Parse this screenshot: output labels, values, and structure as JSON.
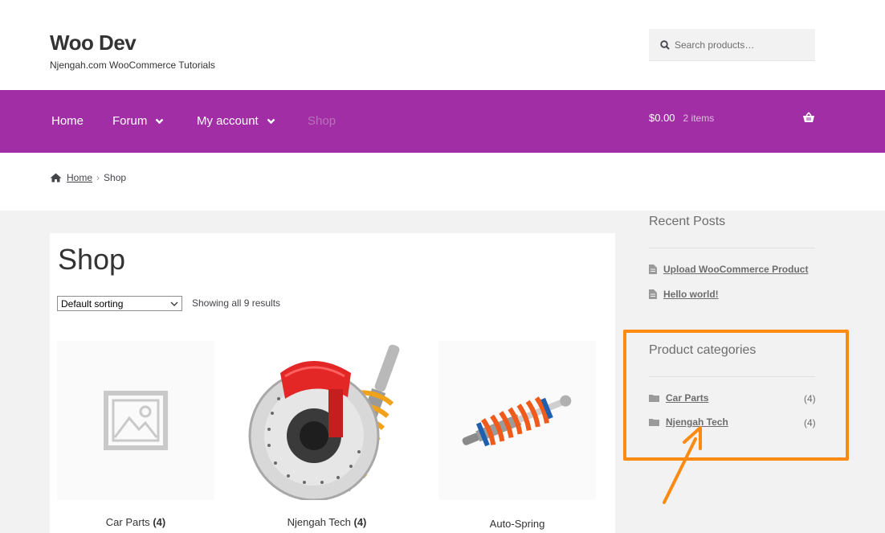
{
  "site": {
    "title": "Woo Dev",
    "tagline": "Njengah.com WooCommerce Tutorials"
  },
  "search": {
    "placeholder": "Search products…"
  },
  "nav": {
    "items": [
      {
        "label": "Home"
      },
      {
        "label": "Forum"
      },
      {
        "label": "My account"
      },
      {
        "label": "Shop"
      }
    ]
  },
  "cart": {
    "total": "$0.00",
    "items": "2 items"
  },
  "breadcrumb": {
    "home": "Home",
    "current": "Shop"
  },
  "main": {
    "title": "Shop",
    "sort_selected": "Default sorting",
    "result_count": "Showing all 9 results"
  },
  "products": [
    {
      "name": "Car Parts",
      "count": "(4)",
      "image": "placeholder-image-icon"
    },
    {
      "name": "Njengah Tech",
      "count": "(4)",
      "image": "brake-shock-photo"
    },
    {
      "name": "Auto-Spring",
      "count": "",
      "image": "shock-absorber-photo"
    }
  ],
  "sidebar": {
    "recent_posts_title": "Recent Posts",
    "recent_posts": [
      {
        "label": "Upload WooCommerce Product"
      },
      {
        "label": "Hello world!"
      }
    ],
    "categories_title": "Product categories",
    "categories": [
      {
        "label": "Car Parts",
        "count": "(4)"
      },
      {
        "label": "Njengah Tech",
        "count": "(4)"
      }
    ]
  },
  "colors": {
    "nav_bg": "#a12ea5",
    "highlight": "#fd8a12",
    "page_bg": "#f2f2f2"
  }
}
